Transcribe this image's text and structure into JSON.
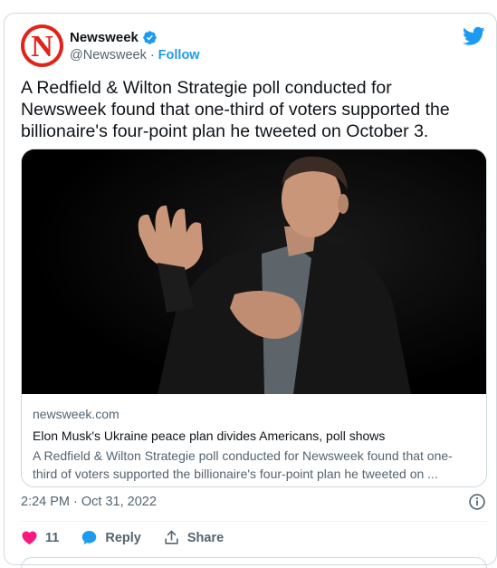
{
  "tweet": {
    "author_name": "Newsweek",
    "author_handle": "@Newsweek",
    "separator": "·",
    "follow_label": "Follow",
    "avatar_letter": "N",
    "text": "A Redfield & Wilton Strategie poll conducted for Newsweek found that one-third of voters supported the billionaire's four-point plan he tweeted on October 3.",
    "timestamp": "2:24 PM · Oct 31, 2022"
  },
  "link_card": {
    "domain": "newsweek.com",
    "title": "Elon Musk's Ukraine peace plan divides Americans, poll shows",
    "description": "A Redfield & Wilton Strategie poll conducted for Newsweek found that one-third of voters supported the billionaire's four-point plan he tweeted on ..."
  },
  "actions": {
    "likes_count": "11",
    "reply_label": "Reply",
    "share_label": "Share"
  },
  "icons": {
    "verified": "verified-badge-icon",
    "bird": "twitter-bird-icon",
    "info": "info-icon",
    "like": "heart-icon",
    "reply": "speech-bubble-icon",
    "share": "share-icon"
  },
  "colors": {
    "brand_blue": "#1d9bf0",
    "newsweek_red": "#e2231a",
    "like_pink": "#f91880",
    "secondary_text": "#536471"
  }
}
